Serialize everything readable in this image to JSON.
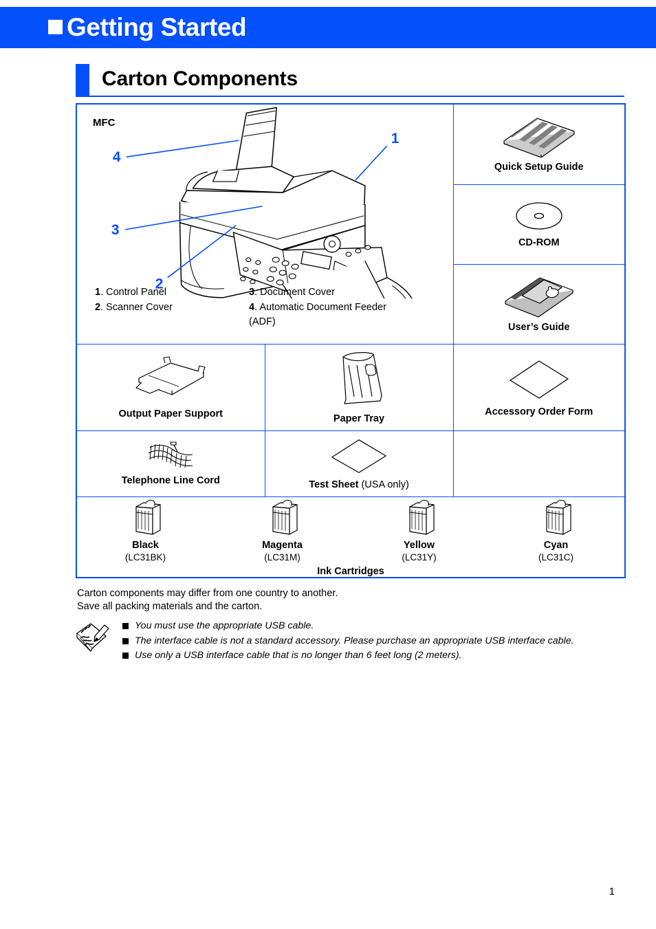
{
  "banner": {
    "title": "Getting Started",
    "square_icon": "filled-square-icon",
    "background_color": "#0450fb",
    "text_color": "#ffffff"
  },
  "section": {
    "title": "Carton Components",
    "accent_color": "#0450fb"
  },
  "table": {
    "mfc": {
      "caption": "MFC",
      "illustration": "mfc-printer-illustration",
      "callouts": [
        "1",
        "2",
        "3",
        "4"
      ],
      "legend": [
        {
          "num": "1",
          "text": "Control Panel"
        },
        {
          "num": "2",
          "text": "Scanner Cover"
        },
        {
          "num": "3",
          "text": "Document Cover"
        },
        {
          "num": "4",
          "text": "Automatic Document Feeder (ADF)"
        }
      ]
    },
    "right_column": [
      {
        "label": "Quick Setup Guide",
        "icon": "booklet-icon"
      },
      {
        "label": "CD-ROM",
        "icon": "cd-disc-icon"
      },
      {
        "label": "User’s Guide",
        "icon": "manual-book-icon"
      }
    ],
    "row_accessories": [
      {
        "label": "Output Paper Support",
        "icon": "output-paper-support-icon"
      },
      {
        "label": "Paper Tray",
        "icon": "paper-tray-icon"
      },
      {
        "label": "Accessory Order Form",
        "icon": "sheet-icon"
      }
    ],
    "row_cables": [
      {
        "label": "Telephone Line Cord",
        "icon": "telephone-cord-icon"
      },
      {
        "label": "Test Sheet",
        "label_suffix": " (USA only)",
        "icon": "sheet-icon"
      },
      {
        "label": "",
        "icon": ""
      }
    ],
    "ink": {
      "caption": "Ink Cartridges",
      "items": [
        {
          "name": "Black",
          "code": "(LC31BK)",
          "icon": "ink-cartridge-icon"
        },
        {
          "name": "Magenta",
          "code": "(LC31M)",
          "icon": "ink-cartridge-icon"
        },
        {
          "name": "Yellow",
          "code": "(LC31Y)",
          "icon": "ink-cartridge-icon"
        },
        {
          "name": "Cyan",
          "code": "(LC31C)",
          "icon": "ink-cartridge-icon"
        }
      ]
    }
  },
  "notes": {
    "line1": "Carton components may differ from one country to another.",
    "line2": "Save all packing materials and the carton."
  },
  "memo": {
    "icon": "notepad-pencil-icon",
    "items": [
      "You must use the appropriate USB cable.",
      "The interface cable is not a standard accessory. Please purchase an appropriate USB interface cable.",
      "Use only a USB interface cable that is no longer than 6 feet long (2 meters)."
    ]
  },
  "footer": {
    "page_number": "1"
  }
}
